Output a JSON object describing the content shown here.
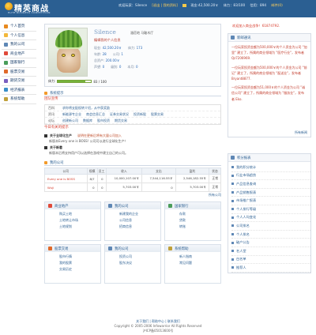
{
  "header": {
    "logo_cn": "精英商战",
    "logo_en": "ELITE BUSINESS COMPETITION",
    "user_label": "欢迎玩家：Silence",
    "user_links": "[退出 | 我的资料]",
    "cash": "现金:42,500.20￥",
    "power": "体力：83/100",
    "credit": "信用：894",
    "msg": "邮件(0)"
  },
  "sidebar": {
    "items": [
      {
        "label": "个人首页",
        "color": "#e88a1e"
      },
      {
        "label": "个人信息",
        "color": "#f2b83b"
      },
      {
        "label": "我的公司",
        "color": "#5e87b5"
      },
      {
        "label": "商业地产",
        "color": "#e04a3a"
      },
      {
        "label": "国家银行",
        "color": "#4a9d5a"
      },
      {
        "label": "股票交易",
        "color": "#e06a2a"
      },
      {
        "label": "期货交易",
        "color": "#7a5ec0"
      },
      {
        "label": "经济报表",
        "color": "#3a8fc8"
      },
      {
        "label": "系统帮助",
        "color": "#c0a03a"
      }
    ]
  },
  "profile": {
    "name": "Silence",
    "sub": "湄莅地 马鞍木厅",
    "signature": "编辑我的个人信息",
    "stats": [
      {
        "label": "现金:",
        "value": "42,500.20￥",
        "label2": "体力:",
        "value2": "173"
      },
      {
        "label": "年龄:",
        "value": "28",
        "label2": "公司:",
        "value2": "1"
      },
      {
        "label": "总资产:",
        "value": "200.00￥",
        "label2": "",
        "value2": ""
      },
      {
        "label": "声望:",
        "value": "0",
        "label2": "级别:",
        "value2": "0",
        "label3": "本月:",
        "value3": "0"
      }
    ],
    "power_label": "体力:",
    "power_value": "83 / 100",
    "power_ratio": 0.83
  },
  "status_title": "系统提示",
  "quick": {
    "title": "团队宣传",
    "rows": [
      {
        "k": "百科",
        "items": [
          "求你将支配权转介绍，从中获奖励"
        ]
      },
      {
        "k": "资讯",
        "items": [
          "新能源专企业",
          "商会信息汇总",
          "证券交易状况",
          "投资新股",
          "股票交易"
        ]
      },
      {
        "k": "论坛",
        "items": [
          "创建新公司",
          "数据库",
          "股市投资",
          "期货交易"
        ]
      }
    ]
  },
  "news_head": "今日有关的提示",
  "news": [
    {
      "title": "关于全球化生产",
      "date": "说明在更新后将有大量公司加入",
      "text": "新版本Every one is BOSS! 公司可以进行全球化生产！"
    },
    {
      "title": "关于新着",
      "date": "",
      "text": "新版本后将支持用户可以选择在游戏中建立自己的公司。"
    }
  ],
  "company_title": "我的公司",
  "company_table": {
    "headers": [
      "公司",
      "规模",
      "员工",
      "收入",
      "支出",
      "盈利",
      "状态"
    ],
    "rows": [
      [
        "Every one is BOSS",
        "8/7",
        "0",
        "10,000,107.00￥",
        "7,544,116.55￥",
        "2,546,182.55￥",
        "正常"
      ],
      [
        "Wuji",
        "0",
        "0",
        "5,703.00￥",
        "0",
        "5,703.00￥",
        "正常"
      ]
    ],
    "all_label": "所有公司"
  },
  "portals": [
    {
      "title": "商业地产",
      "color": "#e04a3a",
      "links": [
        "购买土地",
        "土地转让市场",
        "土地规划"
      ]
    },
    {
      "title": "我的公司",
      "color": "#5e87b5",
      "links": [
        "新建我的企业",
        "公司信息",
        "招商信息"
      ]
    },
    {
      "title": "国家银行",
      "color": "#4a9d5a",
      "links": [
        "存款",
        "贷款",
        "转账"
      ]
    },
    {
      "title": "股票交易",
      "color": "#e06a2a",
      "links": [
        "股市行情",
        "我的股票",
        "交易历史"
      ]
    },
    {
      "title": "我的公司",
      "color": "#5e87b5",
      "links": [
        "投资公司",
        "股东决议"
      ]
    },
    {
      "title": "系统帮助",
      "color": "#c0a03a",
      "links": [
        "新人指南",
        "常见问题"
      ]
    }
  ],
  "right": {
    "welcome": "欢迎加入商业战争！61874792.",
    "notice_title": "新邮通讯",
    "notices": [
      "一位玩家投资金额为500,000￥的个人资金为公司 \"加里\" 建立了，所属的商业领域为 \"医疗行业\"，发布者 Qz7206969.",
      "一位玩家投资金额为500,000￥的个人资金为公司 \"前记\" 建立了，所属的商业领域为 \"配送业\"，发布者 Bryant8877.",
      "一位玩家投资金额为51,000￥的个人资金为公司 \"诚信公司\" 建立了，所属的商业领域为 \"服务业\"，发布者 Eko."
    ],
    "more": "所有新闻",
    "rank_title": "积分报表",
    "rank_items": [
      "我的积分统计",
      "行业市场趋势",
      "产品信息查询",
      "产品销售报表",
      "市场推广报表",
      "个人排行等级",
      "个人人均变化",
      "公司排名",
      "个人排名",
      "破产公告",
      "名人堂",
      "白名单",
      "推荐人"
    ]
  },
  "footer": {
    "links": "关于我们 | 帮助中心 | 联系我们",
    "copyright": "Copyright © 2005-2006 Infowarrior All Rights Reserved",
    "icp": "沪ICP备05013600号"
  }
}
